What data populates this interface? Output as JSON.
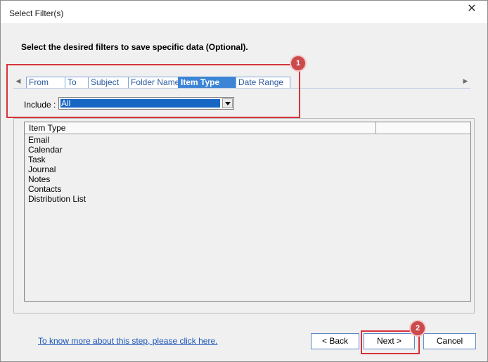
{
  "window": {
    "title": "Select Filter(s)",
    "close_glyph": "✕"
  },
  "instruction": "Select the desired filters to save specific data (Optional).",
  "tabs": [
    {
      "label": "From"
    },
    {
      "label": "To"
    },
    {
      "label": "Subject"
    },
    {
      "label": "Folder Name"
    },
    {
      "label": "Item Type",
      "active": true
    },
    {
      "label": "Date Range"
    }
  ],
  "scroll": {
    "left_glyph": "◀",
    "right_glyph": "▶"
  },
  "include": {
    "label": "Include :",
    "value": "All"
  },
  "list": {
    "column_header": "Item Type",
    "items": [
      "Email",
      "Calendar",
      "Task",
      "Journal",
      "Notes",
      "Contacts",
      "Distribution List"
    ]
  },
  "help_link": "To know more about this step, please click here.",
  "buttons": {
    "back": "< Back",
    "next": "Next >",
    "cancel": "Cancel"
  },
  "annotations": [
    {
      "number": "1"
    },
    {
      "number": "2"
    }
  ],
  "colors": {
    "accent": "#3c84d6",
    "highlight": "#d6333b",
    "badge": "#cc4a4c",
    "selection": "#1766c4"
  }
}
